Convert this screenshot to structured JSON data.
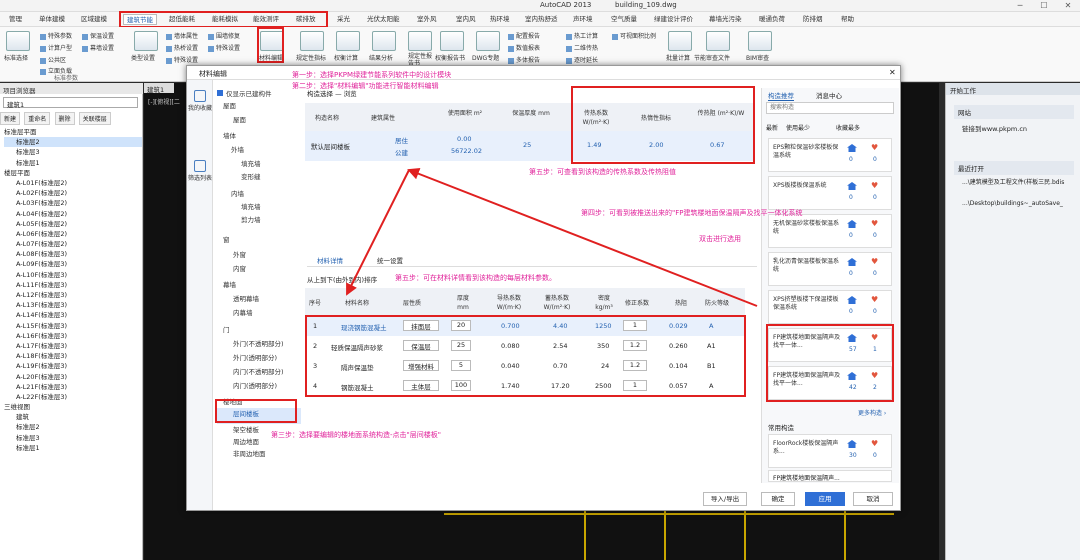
{
  "window": {
    "app_title": "AutoCAD 2013",
    "file": "building_109.dwg",
    "min": "─",
    "max": "☐",
    "close": "✕"
  },
  "menu": [
    "管理",
    "单体建模",
    "区域建模",
    "建筑节能",
    "超低能耗",
    "能耗模拟",
    "能效测评",
    "碳排放",
    "采光",
    "光伏太阳能",
    "室外风",
    "室内风",
    "热环境",
    "室内热舒适",
    "声环境",
    "空气质量",
    "绿建设计评价",
    "幕墙光污染",
    "暖通负荷",
    "防排烟",
    "帮助"
  ],
  "ribbon": {
    "group1": {
      "big": "标准选择",
      "items": [
        "特殊参数",
        "计算户型",
        "公共区",
        "立面负载"
      ],
      "group_label": "标准参数"
    },
    "group2": {
      "items": [
        "保温设置",
        "幕墙设置"
      ]
    },
    "group3": {
      "big": "类型设置",
      "items": [
        "墙体属性",
        "热桥设置",
        "特殊设置",
        "墙体隔热",
        "结构设置"
      ]
    },
    "group4": {
      "items": [
        "围墙修复",
        "特殊设置"
      ]
    },
    "big_buttons": [
      "材料编辑",
      "规定性指标",
      "权衡计算",
      "结果分析",
      "规定性报告书",
      "权衡报告书",
      "DWG专题",
      "配置报告",
      "数值报表",
      "多体报告"
    ],
    "group5": {
      "items": [
        "热工计算",
        "二维传热",
        "逐时延长",
        "可视面积比例"
      ]
    },
    "group6": {
      "items": [
        "批量计算",
        "节能审查文件"
      ]
    },
    "big_last": "BIM审查"
  },
  "left_panel": {
    "title": "项目浏览器",
    "dropdown": "建筑1",
    "buttons": [
      "新建",
      "重命名",
      "删除",
      "关联楼层"
    ],
    "tree": [
      "标准层平面",
      "标准层2",
      "标准层3",
      "标准层1",
      "楼层平面",
      "A-L01F(标准层2)",
      "A-L02F(标准层2)",
      "A-L03F(标准层2)",
      "A-L04F(标准层2)",
      "A-L05F(标准层2)",
      "A-L06F(标准层2)",
      "A-L07F(标准层2)",
      "A-L08F(标准层3)",
      "A-L09F(标准层3)",
      "A-L10F(标准层3)",
      "A-L11F(标准层3)",
      "A-L12F(标准层3)",
      "A-L13F(标准层3)",
      "A-L14F(标准层3)",
      "A-L15F(标准层3)",
      "A-L16F(标准层3)",
      "A-L17F(标准层3)",
      "A-L18F(标准层3)",
      "A-L19F(标准层3)",
      "A-L20F(标准层3)",
      "A-L21F(标准层3)",
      "A-L22F(标准层3)",
      "三维视图",
      "建筑",
      "标准层2",
      "标准层3",
      "标准层1"
    ]
  },
  "canvas": {
    "tab": "建筑1",
    "view": "[-][俯视][二"
  },
  "dialog": {
    "title": "材料编辑",
    "close": "✕",
    "nav": [
      {
        "label": "我的收藏"
      },
      {
        "label": "筛选列表"
      }
    ],
    "filter_checkbox": "仅显示已建构件",
    "tree": [
      "屋面",
      "屋面",
      "墙体",
      "外墙",
      "填充墙",
      "变形缝",
      "内墙",
      "填充墙",
      "剪力墙",
      "窗",
      "外窗",
      "内窗",
      "幕墙",
      "透明幕墙",
      "内幕墙",
      "门",
      "外门(不透明部分)",
      "外门(透明部分)",
      "内门(不透明部分)",
      "内门(透明部分)",
      "楼地面",
      "层间楼板",
      "架空楼板",
      "周边地面",
      "非周边地面"
    ],
    "top_table_title": "构造选择 — 浏览",
    "top_headers": [
      "构造名称",
      "建筑属性",
      "使用面积 m²",
      "保温厚度 mm",
      "传热系数 W/(m²·K)",
      "热惰性指标",
      "传热阻 (m²·K)/W"
    ],
    "top_row": {
      "name": "默认层间楼板",
      "attr1": "居住",
      "attr2": "公建",
      "area1": "0.00",
      "area2": "56722.02",
      "thick": "25",
      "k": "1.49",
      "d": "2.00",
      "r": "0.67"
    },
    "tabs": [
      "材料详情",
      "统一设置"
    ],
    "order_label": "从上到下(由外到内)排序",
    "bottom_headers": [
      "序号",
      "材料名称",
      "层性质",
      "厚度 mm",
      "导热系数 W/(m·K)",
      "蓄热系数 W/(m²·K)",
      "密度 kg/m³",
      "修正系数",
      "热阻",
      "防火等级"
    ],
    "bottom_rows": [
      [
        "1",
        "现浇钢筋混凝土",
        "抹面层",
        "20",
        "0.700",
        "4.40",
        "1250",
        "1",
        "0.029",
        "A"
      ],
      [
        "2",
        "轻质保温隔声砂浆",
        "保温层",
        "25",
        "0.080",
        "2.54",
        "350",
        "1.2",
        "0.260",
        "A1"
      ],
      [
        "3",
        "隔声保温垫",
        "增强材料",
        "5",
        "0.040",
        "0.70",
        "24",
        "1.2",
        "0.104",
        "B1"
      ],
      [
        "4",
        "钢筋混凝土",
        "主体层",
        "100",
        "1.740",
        "17.20",
        "2500",
        "1",
        "0.057",
        "A"
      ]
    ],
    "buttons": {
      "import_export": "导入/导出",
      "confirm": "确定",
      "apply": "应用",
      "cancel": "取消"
    },
    "right_tabs": [
      "构造推荐",
      "消息中心"
    ],
    "search_placeholder": "搜索构造",
    "rec_header": [
      "最新",
      "使用最少",
      "收藏最多"
    ],
    "cards": [
      {
        "name": "EPS颗粒保温砂浆楼板保温系统",
        "c1": "0",
        "c2": "0"
      },
      {
        "name": "XPS板楼板保温系统",
        "c1": "0",
        "c2": "0"
      },
      {
        "name": "无机保温砂浆楼板保温系统",
        "c1": "0",
        "c2": "0"
      },
      {
        "name": "乳化沥青保温楼板保温系统",
        "c1": "0",
        "c2": "0"
      },
      {
        "name": "XPS挤塑板楼下保温楼板保温系统",
        "c1": "0",
        "c2": "0"
      },
      {
        "name": "FP建筑楼地面保温隔声及找平一体...",
        "c1": "57",
        "c2": "1"
      },
      {
        "name": "FP建筑楼地面保温隔声及找平一体...",
        "c1": "42",
        "c2": "2"
      }
    ],
    "more_link": "更多构造 ›",
    "common_label": "常用构造",
    "common_cards": [
      {
        "name": "FloorRock楼板保温隔声系...",
        "c1": "30",
        "c2": "0"
      },
      {
        "name": "FP建筑楼地面保温隔声...",
        "c1": "0",
        "c2": "0"
      }
    ]
  },
  "annotations": {
    "step1": "第一步：选择PKPM绿建节能系列软件中的设计模块",
    "step2": "第二步：选择\"材料编辑\"功能进行智能材料编辑",
    "step3": "第三步：选择要编辑的楼地面系统构造-点击\"层间楼板\"",
    "step4a": "第四步：可看到被推送出来的\"FP建筑楼地面保温隔声及找平一体化系统",
    "step4b": "双击进行选用",
    "step5a": "第五步：可查看到该构造的传热系数及传热阻值",
    "step5b": "第五步：可在材料详情看到该构造的每层材料参数。"
  },
  "right_panel": {
    "title": "开始工作",
    "sec1": "网站",
    "link1": "链接到www.pkpm.cn",
    "sec2": "最近打开",
    "recent1": "...\\建筑模型及工程文件(样板三民.bdis",
    "recent2": "...\\Desktop\\buildings~_autoSave_"
  },
  "watermark": "大数跨境"
}
